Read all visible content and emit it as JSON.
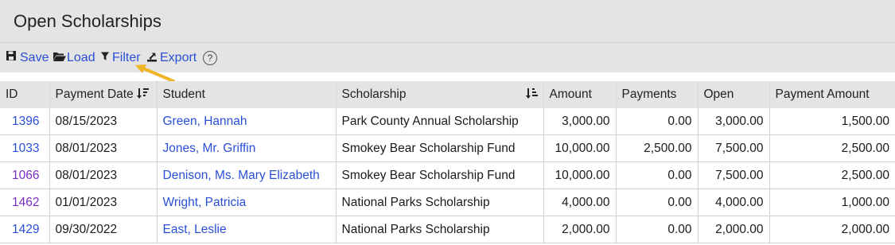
{
  "page": {
    "title": "Open Scholarships"
  },
  "toolbar": {
    "save_label": "Save",
    "load_label": "Load",
    "filter_label": "Filter",
    "export_label": "Export",
    "help_label": "?"
  },
  "colors": {
    "link": "#2a4fd6",
    "visited_link": "#7a2fc4",
    "header_bg": "#e4e4e4",
    "arrow": "#f0b429"
  },
  "table": {
    "columns": [
      "ID",
      "Payment Date",
      "Student",
      "Scholarship",
      "Amount",
      "Payments",
      "Open",
      "Payment Amount"
    ],
    "rows": [
      {
        "id": "1396",
        "date": "08/15/2023",
        "student": "Green, Hannah",
        "scholarship": "Park County Annual Scholarship",
        "amount": "3,000.00",
        "payments": "0.00",
        "open": "3,000.00",
        "payment_amount": "1,500.00",
        "visited": false
      },
      {
        "id": "1033",
        "date": "08/01/2023",
        "student": "Jones, Mr. Griffin",
        "scholarship": "Smokey Bear Scholarship Fund",
        "amount": "10,000.00",
        "payments": "2,500.00",
        "open": "7,500.00",
        "payment_amount": "2,500.00",
        "visited": false
      },
      {
        "id": "1066",
        "date": "08/01/2023",
        "student": "Denison, Ms. Mary Elizabeth",
        "scholarship": "Smokey Bear Scholarship Fund",
        "amount": "10,000.00",
        "payments": "0.00",
        "open": "7,500.00",
        "payment_amount": "2,500.00",
        "visited": true
      },
      {
        "id": "1462",
        "date": "01/01/2023",
        "student": "Wright, Patricia",
        "scholarship": "National Parks Scholarship",
        "amount": "4,000.00",
        "payments": "0.00",
        "open": "4,000.00",
        "payment_amount": "1,000.00",
        "visited": true
      },
      {
        "id": "1429",
        "date": "09/30/2022",
        "student": "East, Leslie",
        "scholarship": "National Parks Scholarship",
        "amount": "2,000.00",
        "payments": "0.00",
        "open": "2,000.00",
        "payment_amount": "2,000.00",
        "visited": false
      }
    ]
  }
}
